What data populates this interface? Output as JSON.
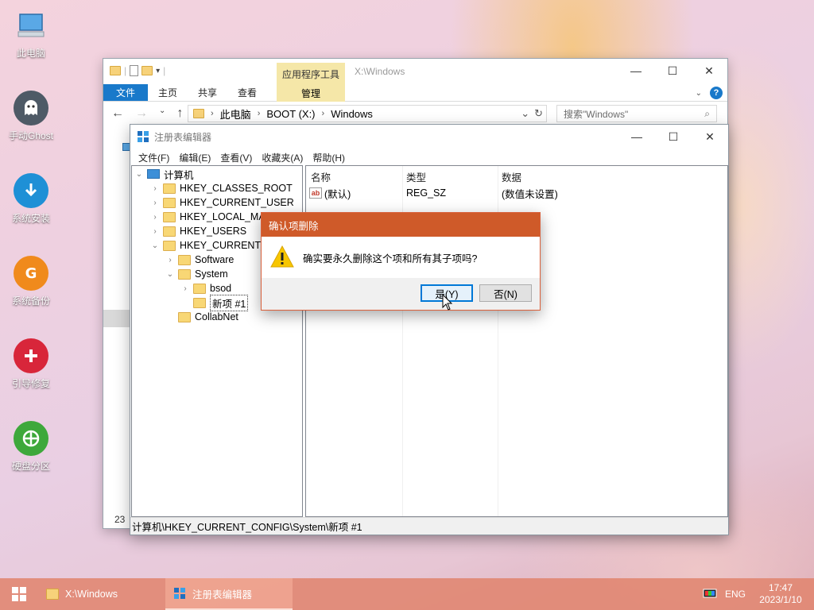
{
  "desktop": {
    "icons": [
      {
        "label": "此电脑",
        "icon": "computer-icon"
      },
      {
        "label": "手动Ghost",
        "icon": "ghost-icon"
      },
      {
        "label": "系统安装",
        "icon": "install-icon"
      },
      {
        "label": "系统备份",
        "icon": "backup-icon"
      },
      {
        "label": "引导修复",
        "icon": "repair-icon"
      },
      {
        "label": "硬盘分区",
        "icon": "partition-icon"
      }
    ]
  },
  "explorer": {
    "context_tab": "应用程序工具",
    "title_path": "X:\\Windows",
    "ribbon_tabs": [
      "文件",
      "主页",
      "共享",
      "查看"
    ],
    "manage_tab": "管理",
    "address": [
      "此电脑",
      "BOOT (X:)",
      "Windows"
    ],
    "search_placeholder": "搜索\"Windows\"",
    "item_count": "23"
  },
  "regedit": {
    "title": "注册表编辑器",
    "menu": [
      "文件(F)",
      "编辑(E)",
      "查看(V)",
      "收藏夹(A)",
      "帮助(H)"
    ],
    "tree": {
      "root": "计算机",
      "hives": [
        "HKEY_CLASSES_ROOT",
        "HKEY_CURRENT_USER",
        "HKEY_LOCAL_MA",
        "HKEY_USERS",
        "HKEY_CURRENT_C"
      ],
      "config_children": [
        "Software",
        "System"
      ],
      "system_children": [
        "bsod",
        "新项 #1"
      ],
      "collabnet": "CollabNet"
    },
    "list": {
      "columns": [
        "名称",
        "类型",
        "数据"
      ],
      "rows": [
        {
          "name": "(默认)",
          "type": "REG_SZ",
          "data": "(数值未设置)"
        }
      ]
    },
    "status": "计算机\\HKEY_CURRENT_CONFIG\\System\\新项 #1"
  },
  "dialog": {
    "title": "确认项删除",
    "message": "确实要永久删除这个项和所有其子项吗?",
    "yes": "是(Y)",
    "no": "否(N)"
  },
  "taskbar": {
    "items": [
      {
        "label": "X:\\Windows",
        "active": false
      },
      {
        "label": "注册表编辑器",
        "active": true
      }
    ],
    "lang": "ENG",
    "time": "17:47",
    "date": "2023/1/10"
  },
  "colors": {
    "accent": "#1979ca",
    "dialog_title": "#cf5a29",
    "taskbar": "#e08570"
  }
}
